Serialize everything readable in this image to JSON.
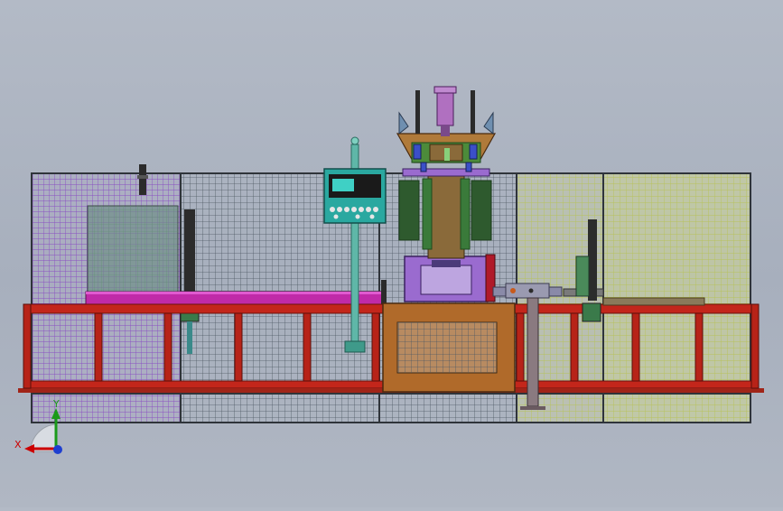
{
  "viewport": {
    "background": "#abb2bf",
    "theme": "cad-model-viewport"
  },
  "model": {
    "colors": {
      "fence_frame": "#3a3f46",
      "mesh": "#55606b",
      "purple_guard": "#8a4fc2",
      "yellow_guard": "#c9d27a",
      "base_frame": "#c3261b",
      "press_body": "#8a5d2c",
      "press_column": "#b07a3a",
      "press_green": "#4c8b3a",
      "press_blue": "#3b4fc8",
      "press_violet": "#9a6bcf",
      "conveyor_magenta": "#c02aa8",
      "control_panel": "#2aa8a0",
      "leg_steel": "#707070"
    },
    "icons": {
      "control_panel": "control-panel-icon",
      "press_cylinder": "cylinder-icon"
    }
  },
  "triad": {
    "x_label": "X",
    "y_label": "Y",
    "x_color": "#cc0000",
    "y_color": "#1a9a1a",
    "z_color": "#1e3fd0"
  }
}
